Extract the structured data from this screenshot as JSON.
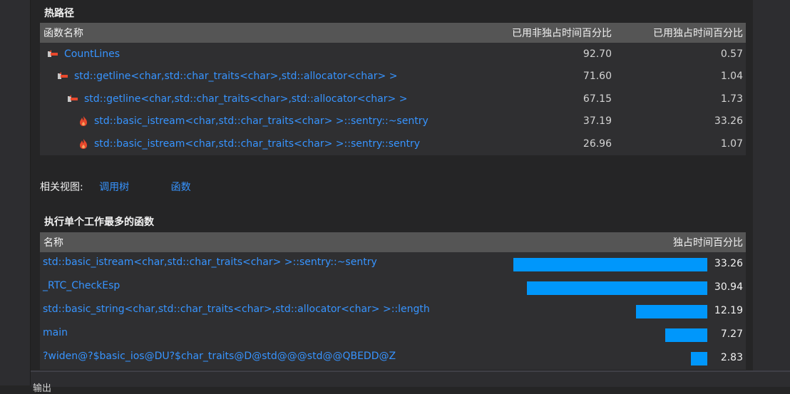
{
  "hot_path": {
    "title": "热路径",
    "columns": [
      "函数名称",
      "已用非独占时间百分比",
      "已用独占时间百分比"
    ],
    "rows": [
      {
        "name": "CountLines",
        "inclusive": "92.70",
        "exclusive": "0.57",
        "icon": "hot-path-arrow-icon"
      },
      {
        "name": "std::getline<char,std::char_traits<char>,std::allocator<char> >",
        "inclusive": "71.60",
        "exclusive": "1.04",
        "icon": "hot-path-arrow-icon"
      },
      {
        "name": "std::getline<char,std::char_traits<char>,std::allocator<char> >",
        "inclusive": "67.15",
        "exclusive": "1.73",
        "icon": "hot-path-arrow-icon"
      },
      {
        "name": "std::basic_istream<char,std::char_traits<char> >::sentry::~sentry",
        "inclusive": "37.19",
        "exclusive": "33.26",
        "icon": "flame-icon"
      },
      {
        "name": "std::basic_istream<char,std::char_traits<char> >::sentry::sentry",
        "inclusive": "26.96",
        "exclusive": "1.07",
        "icon": "flame-icon"
      }
    ]
  },
  "related_views": {
    "label": "相关视图:",
    "links": [
      "调用树",
      "函数"
    ]
  },
  "top_functions": {
    "title": "执行单个工作最多的函数",
    "columns": [
      "名称",
      "独占时间百分比"
    ],
    "rows": [
      {
        "name": "std::basic_istream<char,std::char_traits<char> >::sentry::~sentry",
        "value": "33.26"
      },
      {
        "name": "_RTC_CheckEsp",
        "value": "30.94"
      },
      {
        "name": "std::basic_string<char,std::char_traits<char>,std::allocator<char> >::length",
        "value": "12.19"
      },
      {
        "name": "main",
        "value": "7.27"
      },
      {
        "name": "?widen@?$basic_ios@DU?$char_traits@D@std@@@std@@QBEDD@Z",
        "value": "2.83"
      }
    ]
  },
  "bottom_panel": {
    "label": "输出"
  },
  "colors": {
    "accent": "#0097fb",
    "link": "#3794ff",
    "header": "#555555",
    "flame": "#e8482c"
  }
}
